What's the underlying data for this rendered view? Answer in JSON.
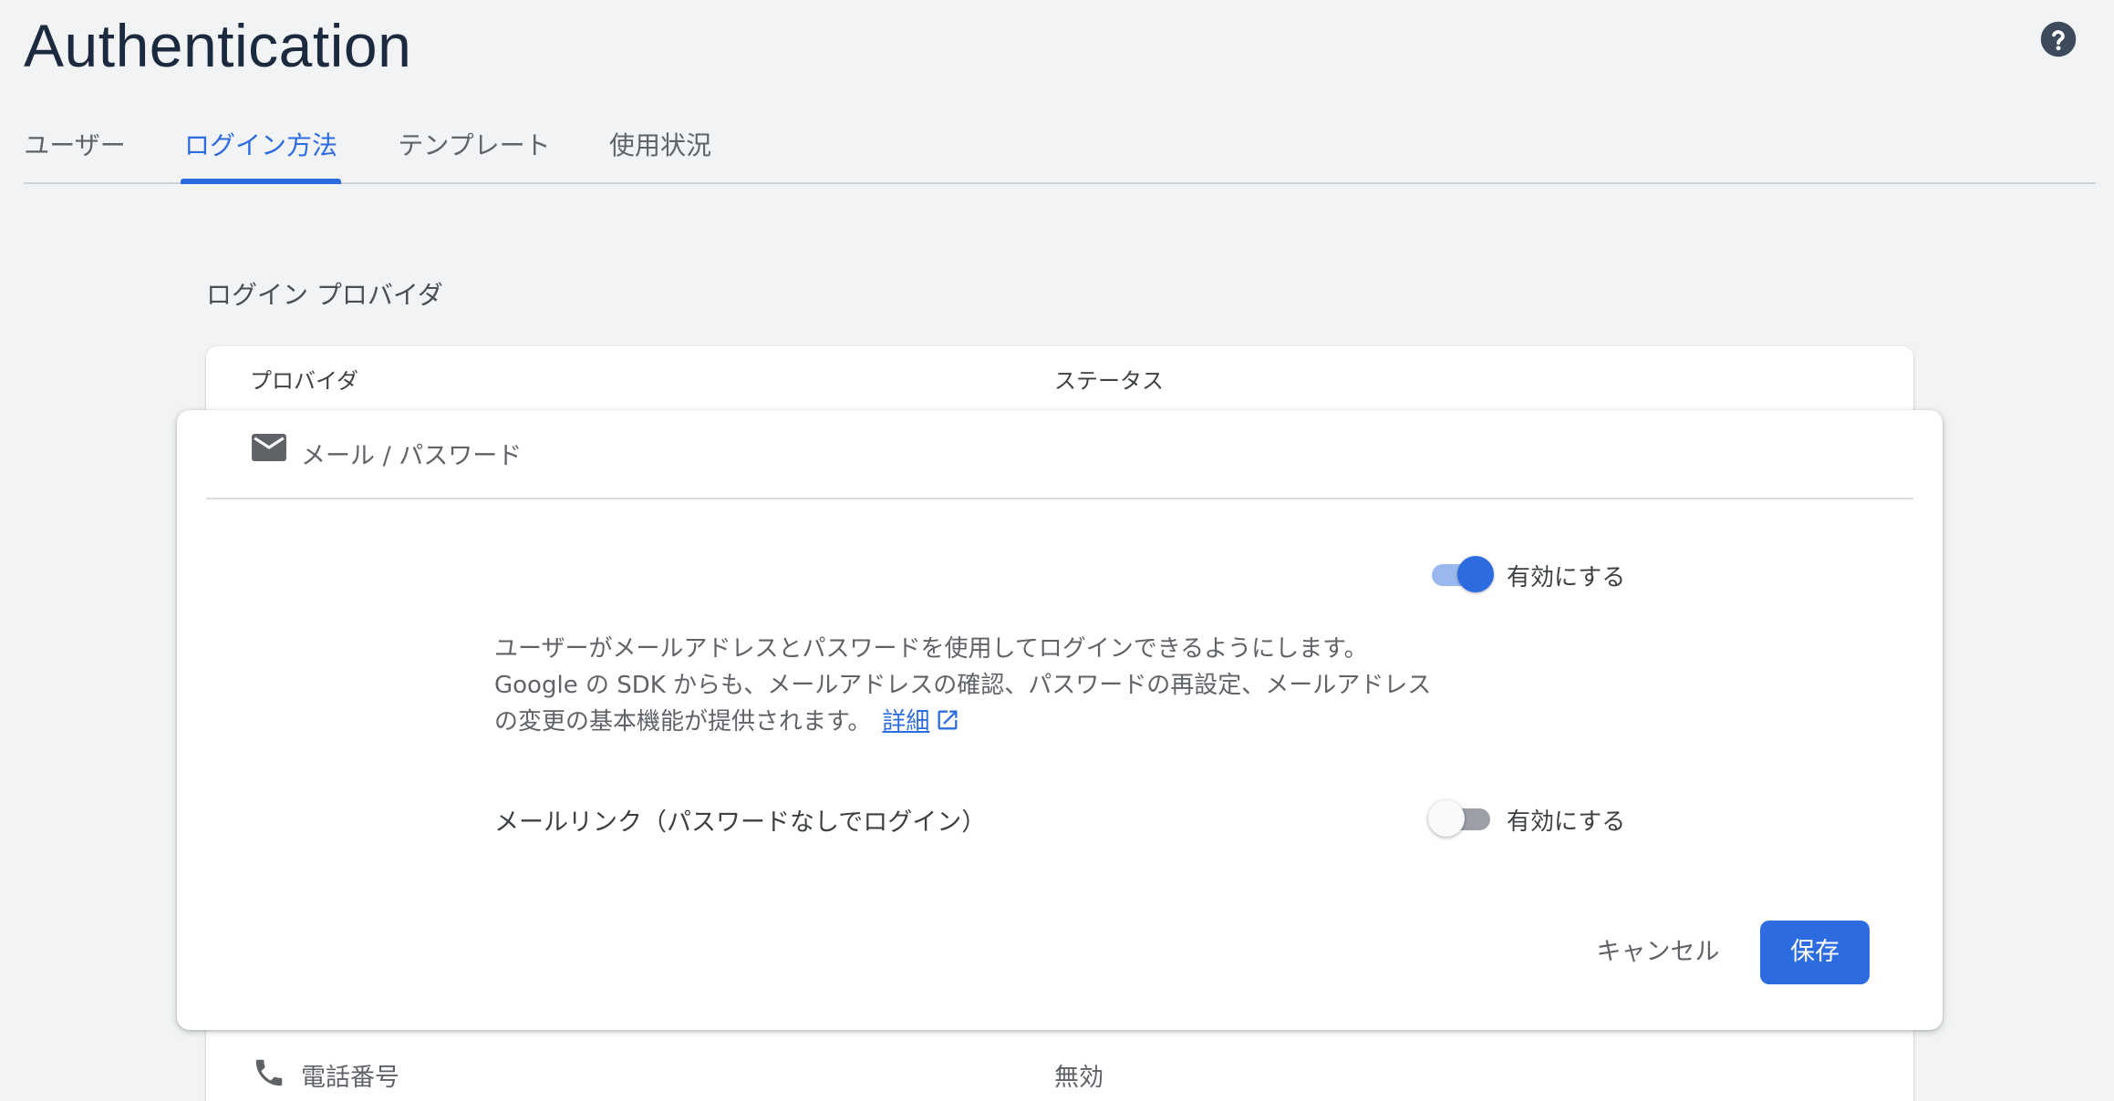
{
  "header": {
    "title": "Authentication",
    "help_icon": "help-circle-icon"
  },
  "tabs": [
    {
      "label": "ユーザー",
      "active": false
    },
    {
      "label": "ログイン方法",
      "active": true
    },
    {
      "label": "テンプレート",
      "active": false
    },
    {
      "label": "使用状況",
      "active": false
    }
  ],
  "section": {
    "title": "ログイン プロバイダ"
  },
  "table": {
    "columns": [
      "プロバイダ",
      "ステータス"
    ]
  },
  "email_provider": {
    "icon": "mail-icon",
    "title": "メール / パスワード",
    "enable_toggle": {
      "label": "有効にする",
      "on": true
    },
    "description": "ユーザーがメールアドレスとパスワードを使用してログインできるようにします。Google の SDK からも、メールアドレスの確認、パスワードの再設定、メールアドレスの変更の基本機能が提供されます。",
    "learn_more": "詳細",
    "email_link": {
      "label": "メールリンク（パスワードなしでログイン）",
      "toggle_label": "有効にする",
      "on": false
    },
    "cancel_label": "キャンセル",
    "save_label": "保存"
  },
  "phone_provider": {
    "icon": "phone-icon",
    "name": "電話番号",
    "status": "無効"
  },
  "colors": {
    "accent": "#2d6ce0",
    "background": "#f1f3f4",
    "title": "#1c2a3f"
  }
}
